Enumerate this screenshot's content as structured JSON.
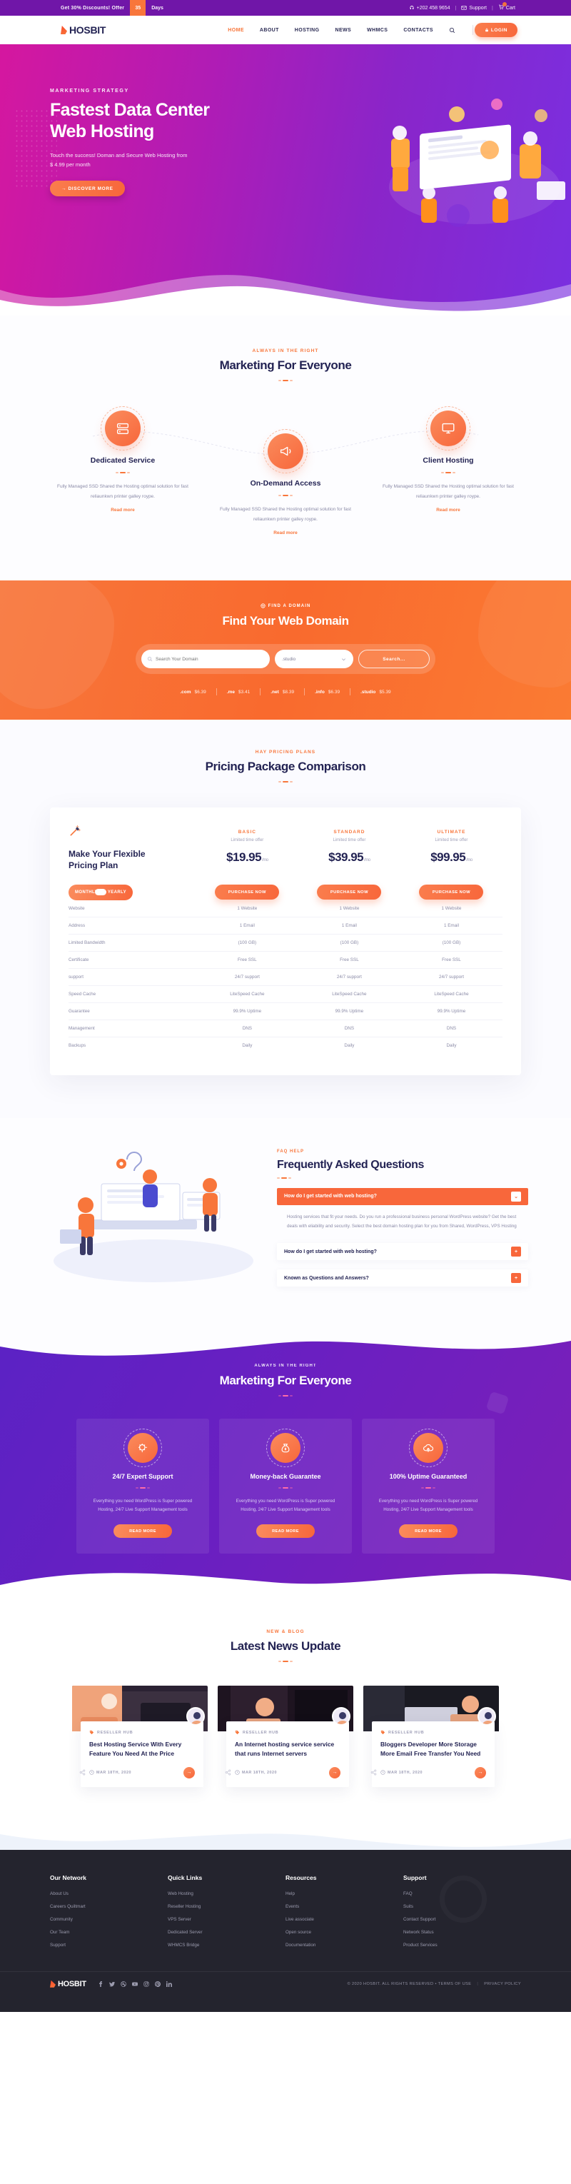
{
  "topbar": {
    "offer_text": "Get 30% Discounts! Offer",
    "countdown": "35",
    "days_label": "Days",
    "phone": "+202 458 9654",
    "support_label": "Support",
    "cart_label": "Cart",
    "sep": "|"
  },
  "nav": {
    "logo": "HOSBIT",
    "items": [
      {
        "label": "HOME",
        "active": true
      },
      {
        "label": "ABOUT",
        "active": false
      },
      {
        "label": "HOSTING",
        "active": false
      },
      {
        "label": "NEWS",
        "active": false
      },
      {
        "label": "WHMCS",
        "active": false
      },
      {
        "label": "CONTACTS",
        "active": false
      }
    ],
    "login_label": "LOGIN"
  },
  "hero": {
    "eyebrow": "MARKETING STRATEGY",
    "title_line1": "Fastest Data Center",
    "title_line2": "Web Hosting",
    "desc_line1": "Touch the success! Doman and Secure Web Hosting from",
    "desc_line2": "$ 4.99 per month",
    "cta": "DISCOVER MORE"
  },
  "services": {
    "eyebrow": "ALWAYS IN THE RIGHT",
    "title": "Marketing For Everyone",
    "cards": [
      {
        "title": "Dedicated Service",
        "desc": "Fully Managed SSD Shared the Hosting optimal solution for fast reliaunkwn printer galley roype.",
        "link": "Read more"
      },
      {
        "title": "On-Demand Access",
        "desc": "Fully Managed SSD Shared the Hosting optimal solution for fast reliaunkwn printer galley roype.",
        "link": "Read more"
      },
      {
        "title": "Client Hosting",
        "desc": "Fully Managed SSD Shared the Hosting optimal solution for fast reliaunkwn printer galley roype.",
        "link": "Read more"
      }
    ]
  },
  "domain": {
    "eyebrow": "FIND A DOMAIN",
    "title": "Find Your Web Domain",
    "input_placeholder": "Search Your Domain",
    "select_value": ".studio",
    "search_button": "Search...",
    "tlds": [
      {
        "name": ".com",
        "price": "$6.39"
      },
      {
        "name": ".me",
        "price": "$3.41"
      },
      {
        "name": ".net",
        "price": "$8.39"
      },
      {
        "name": ".info",
        "price": "$6.39"
      },
      {
        "name": ".studio",
        "price": "$5.39"
      }
    ]
  },
  "pricing": {
    "eyebrow": "HAY PRICING PLANS",
    "title": "Pricing Package Comparison",
    "left_title_line1": "Make Your Flexible",
    "left_title_line2": "Pricing Plan",
    "toggle_monthly": "MONTHLY",
    "toggle_yearly": "YEARLY",
    "plans": [
      {
        "name": "BASIC",
        "limited": "Limited time offer",
        "price": "$19.95",
        "per": "/mo",
        "cta": "PURCHASE NOW"
      },
      {
        "name": "STANDARD",
        "limited": "Limited time offer",
        "price": "$39.95",
        "per": "/mo",
        "cta": "PURCHASE NOW"
      },
      {
        "name": "ULTIMATE",
        "limited": "Limited time offer",
        "price": "$99.95",
        "per": "/mo",
        "cta": "PURCHASE NOW"
      }
    ],
    "features": [
      {
        "label": "Website",
        "basic": "1 Website",
        "standard": "1 Website",
        "ultimate": "1 Website"
      },
      {
        "label": "Address",
        "basic": "1 Email",
        "standard": "1 Email",
        "ultimate": "1 Email"
      },
      {
        "label": "Limited Bandwidth",
        "basic": "(100 GB)",
        "standard": "(100 GB)",
        "ultimate": "(100 GB)"
      },
      {
        "label": "Certificate",
        "basic": "Free SSL",
        "standard": "Free SSL",
        "ultimate": "Free SSL"
      },
      {
        "label": "support",
        "basic": "24/7 support",
        "standard": "24/7 support",
        "ultimate": "24/7 support"
      },
      {
        "label": "Speed Cache",
        "basic": "LiteSpeed Cache",
        "standard": "LiteSpeed Cache",
        "ultimate": "LiteSpeed Cache"
      },
      {
        "label": "Guarantee",
        "basic": "99.9% Uptime",
        "standard": "99.9% Uptime",
        "ultimate": "99.9% Uptime"
      },
      {
        "label": "Management",
        "basic": "DNS",
        "standard": "DNS",
        "ultimate": "DNS"
      },
      {
        "label": "Backups",
        "basic": "Daily",
        "standard": "Daily",
        "ultimate": "Daily"
      }
    ]
  },
  "faq": {
    "eyebrow": "FAQ HELP",
    "title": "Frequently Asked Questions",
    "items": [
      {
        "question": "How do I get started with web hosting?",
        "answer": "Hosting services that fit your needs. Do you run a professional business personal WordPress website? Get the best deals with eliability and security. Select the best domain hosting plan for you from Shared, WordPress, VPS Hosting",
        "open": true,
        "toggle": "⌄"
      },
      {
        "question": "How do I get started with web hosting?",
        "answer": "",
        "open": false,
        "toggle": "+"
      },
      {
        "question": "Known as Questions and Answers?",
        "answer": "",
        "open": false,
        "toggle": "+"
      }
    ]
  },
  "features": {
    "eyebrow": "ALWAYS IN THE RIGHT",
    "title": "Marketing For Everyone",
    "cards": [
      {
        "icon": "support-gear-icon",
        "title": "24/7 Expert Support",
        "desc": "Everything you need WordPress is Super powered Hosting, 24/7 Live Support Management tools",
        "cta": "READ MORE"
      },
      {
        "icon": "money-bag-icon",
        "title": "Money-back Guarantee",
        "desc": "Everything you need WordPress is Super powered Hosting, 24/7 Live Support Management tools",
        "cta": "READ MORE"
      },
      {
        "icon": "uptime-cloud-icon",
        "title": "100% Uptime Guaranteed",
        "desc": "Everything you need WordPress is Super powered Hosting, 24/7 Live Support Management tools",
        "cta": "READ MORE"
      }
    ]
  },
  "news": {
    "eyebrow": "NEW & BLOG",
    "title": "Latest News Update",
    "cards": [
      {
        "category": "RESELLER HUB",
        "title": "Best Hosting Service With Every Feature You Need At the Price",
        "date": "MAR 18TH, 2020",
        "arrow": "→"
      },
      {
        "category": "RESELLER HUB",
        "title": "An Internet hosting service service that runs Internet servers",
        "date": "MAR 18TH, 2020",
        "arrow": "→"
      },
      {
        "category": "RESELLER HUB",
        "title": "Bloggers Developer More Storage More Email Free Transfer You Need",
        "date": "MAR 18TH, 2020",
        "arrow": "→"
      }
    ]
  },
  "footer": {
    "columns": [
      {
        "title": "Our Network",
        "links": [
          "About Us",
          "Careers Quiltmart",
          "Community",
          "Our Team",
          "Support"
        ]
      },
      {
        "title": "Quick Links",
        "links": [
          "Web Hosting",
          "Reseller Hosting",
          "VPS Server",
          "Dedicated Server",
          "WHMCS Bridge"
        ]
      },
      {
        "title": "Resources",
        "links": [
          "Help",
          "Events",
          "Live associate",
          "Open source",
          "Documentation"
        ]
      },
      {
        "title": "Support",
        "links": [
          "FAQ",
          "Suits",
          "Contact Support",
          "Network Status",
          "Product Services"
        ]
      }
    ],
    "logo": "HOSBIT",
    "socials": [
      "facebook-icon",
      "twitter-icon",
      "dribbble-icon",
      "youtube-icon",
      "instagram-icon",
      "pinterest-icon",
      "linkedin-icon"
    ],
    "copyright": "© 2020 HOSBIT. ALL RIGHTS RESERVED • TERMS OF USE",
    "copyright_bar": "|",
    "privacy": "PRIVACY POLICY"
  },
  "colors": {
    "accent": "#f8673b",
    "purple": "#7016a8",
    "dark": "#232353",
    "footer_bg": "#24242e"
  }
}
